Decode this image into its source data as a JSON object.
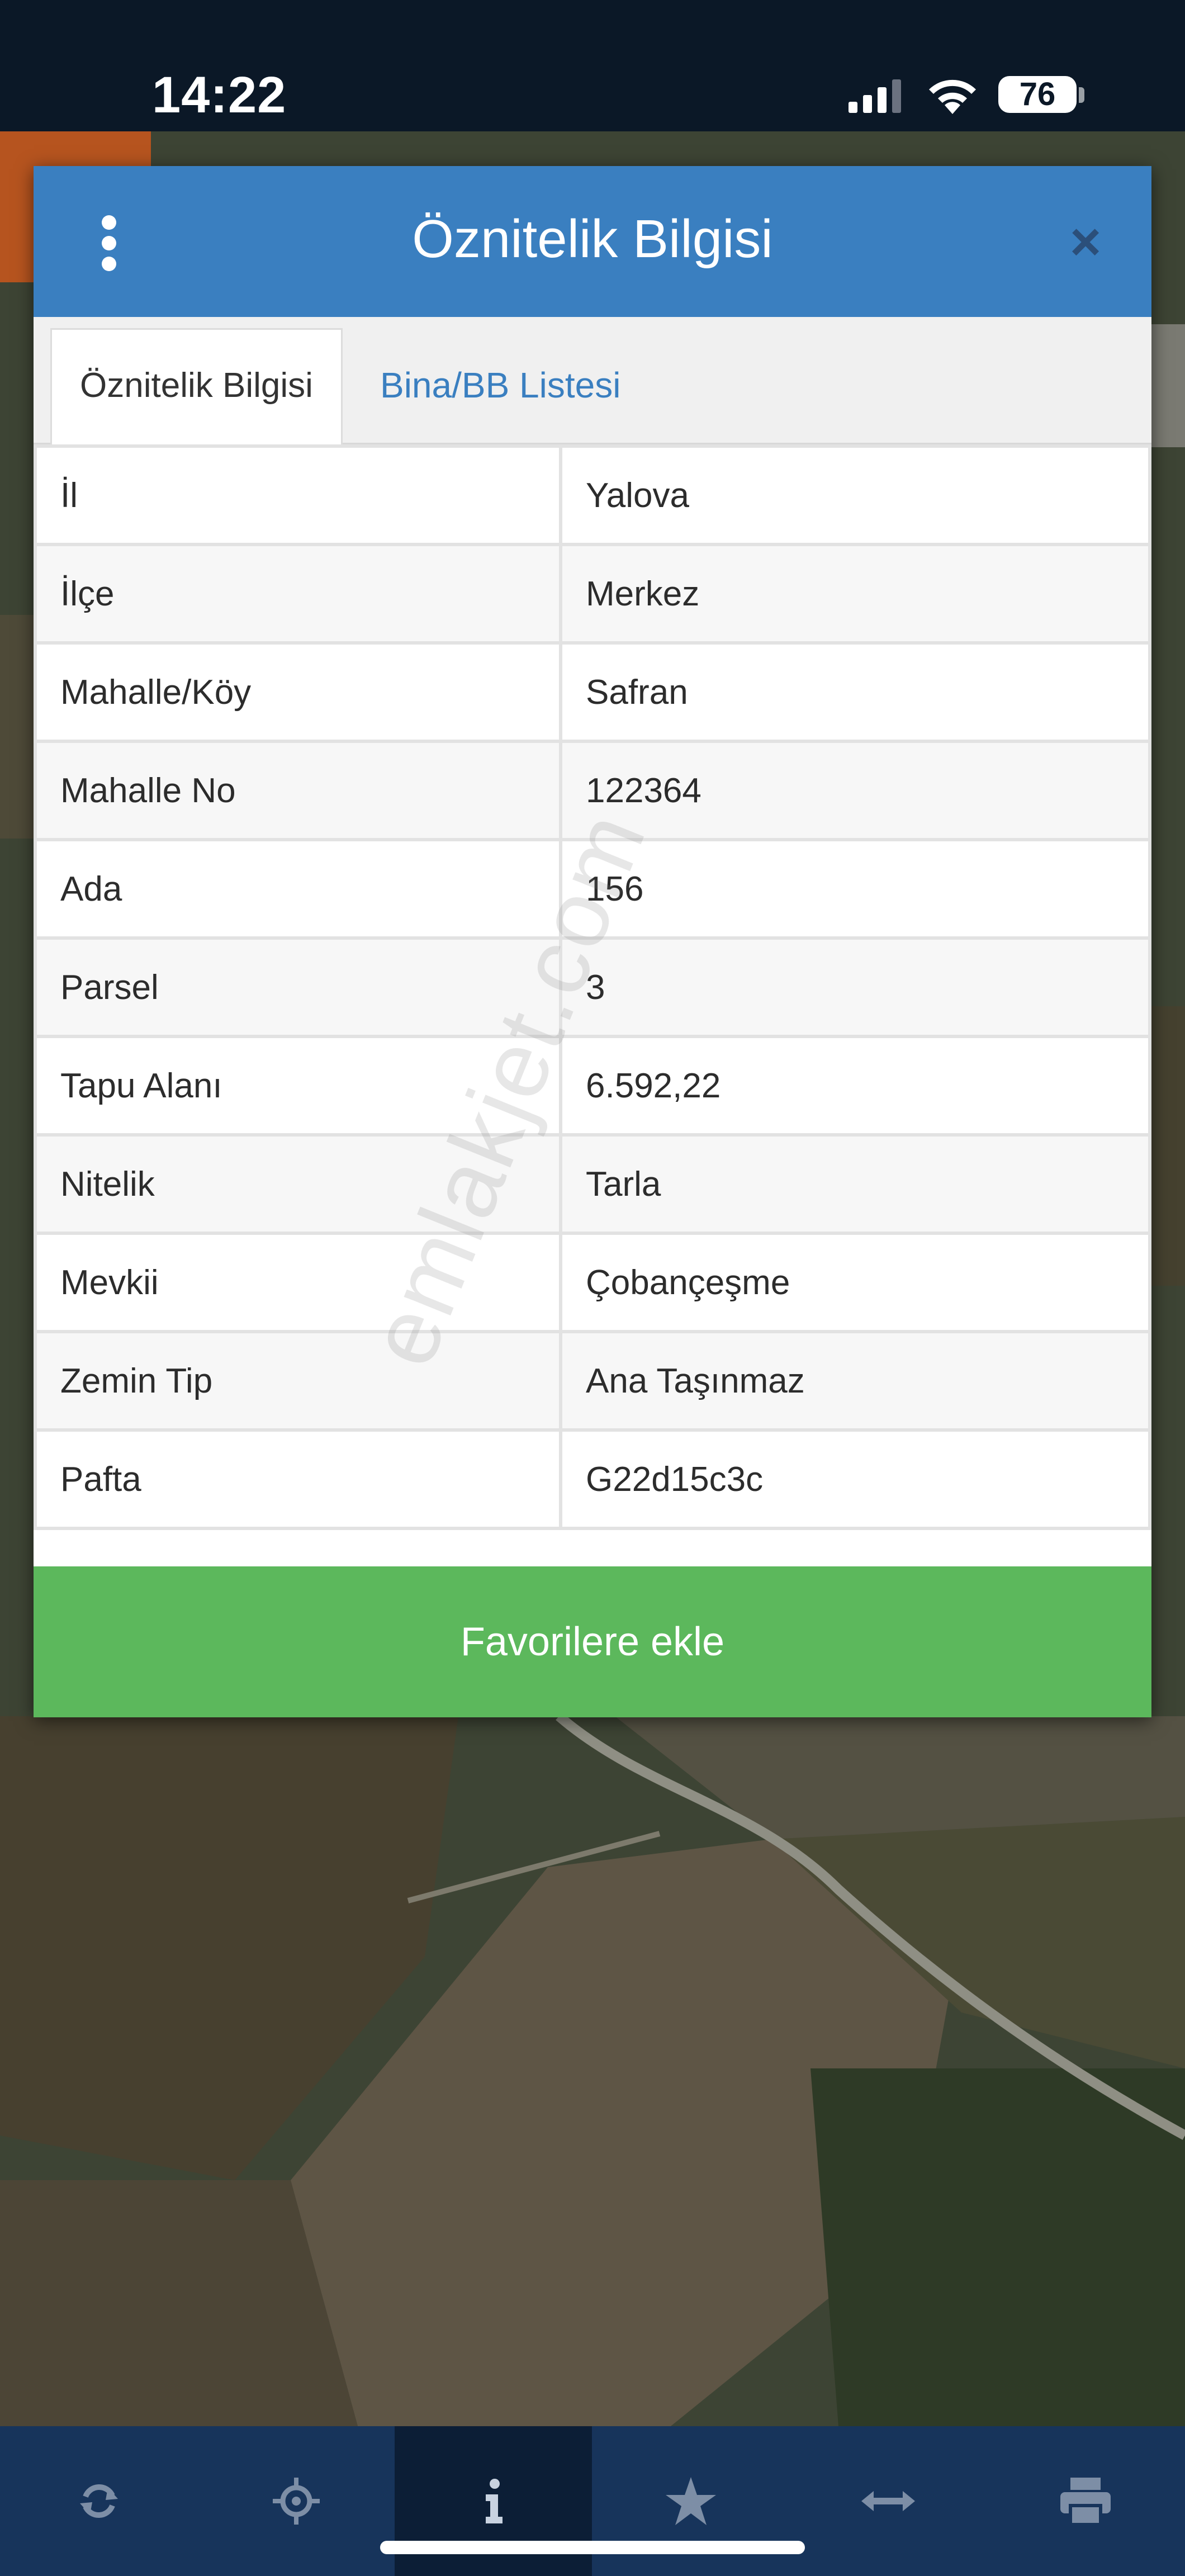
{
  "status_bar": {
    "time": "14:22",
    "battery": "76",
    "icons": [
      "signal-icon",
      "wifi-icon",
      "battery-icon"
    ]
  },
  "dialog": {
    "title": "Öznitelik Bilgisi",
    "menu_icon": "kebab-menu-icon",
    "close_icon": "close-icon",
    "tabs": [
      {
        "label": "Öznitelik Bilgisi",
        "active": true
      },
      {
        "label": "Bina/BB Listesi",
        "active": false
      }
    ],
    "rows": [
      {
        "key": "İl",
        "value": "Yalova"
      },
      {
        "key": "İlçe",
        "value": "Merkez"
      },
      {
        "key": "Mahalle/Köy",
        "value": "Safran"
      },
      {
        "key": "Mahalle No",
        "value": "122364"
      },
      {
        "key": "Ada",
        "value": "156"
      },
      {
        "key": "Parsel",
        "value": "3"
      },
      {
        "key": "Tapu Alanı",
        "value": "6.592,22"
      },
      {
        "key": "Nitelik",
        "value": "Tarla"
      },
      {
        "key": "Mevkii",
        "value": "Çobançeşme"
      },
      {
        "key": "Zemin Tip",
        "value": "Ana Taşınmaz"
      },
      {
        "key": "Pafta",
        "value": "G22d15c3c"
      }
    ],
    "favorite_button": "Favorilere ekle",
    "watermark": "emlakjet.com"
  },
  "toolbar": {
    "items": [
      {
        "icon": "refresh-icon",
        "active": false
      },
      {
        "icon": "locate-icon",
        "active": false
      },
      {
        "icon": "info-icon",
        "active": true
      },
      {
        "icon": "star-icon",
        "active": false
      },
      {
        "icon": "measure-icon",
        "active": false
      },
      {
        "icon": "print-icon",
        "active": false
      }
    ]
  },
  "colors": {
    "header_blue": "#3a7fc0",
    "favorite_green": "#5cb85c",
    "toolbar_navy": "#17345b",
    "status_bar": "#0b1827"
  }
}
